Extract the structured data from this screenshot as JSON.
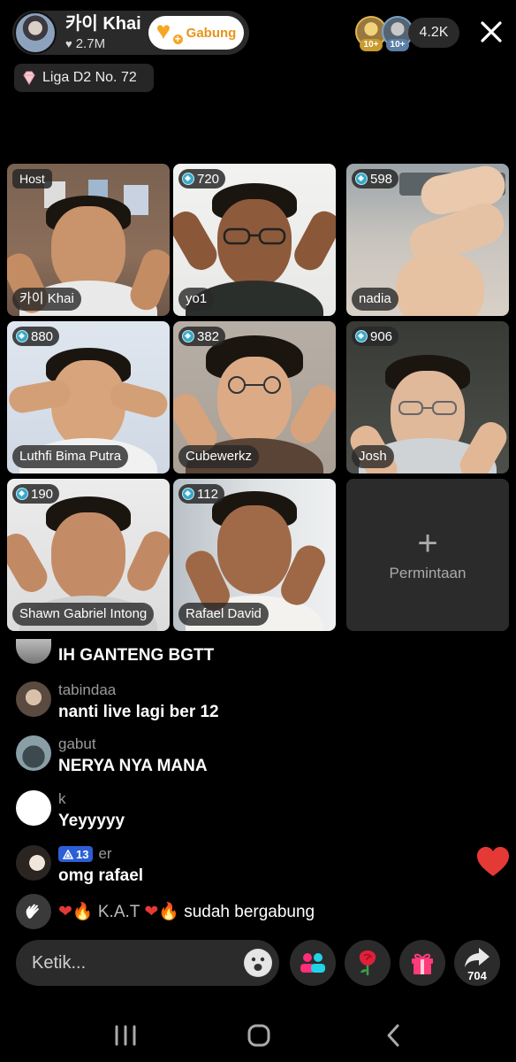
{
  "header": {
    "host_name": "카이 Khai",
    "host_likes": "2.7M",
    "join_label": "Gabung",
    "viewer_ranks": [
      "10+",
      "10+"
    ],
    "viewer_count": "4.2K",
    "league": "Liga D2 No. 72"
  },
  "grid": {
    "host_badge": "Host",
    "tiles": [
      {
        "name": "카이 Khai",
        "badge": "Host"
      },
      {
        "name": "yo1",
        "badge": "720"
      },
      {
        "name": "nadia",
        "badge": "598"
      },
      {
        "name": "Luthfi Bima Putra",
        "badge": "880"
      },
      {
        "name": "Cubewerkz",
        "badge": "382"
      },
      {
        "name": "Josh",
        "badge": "906"
      },
      {
        "name": "Shawn Gabriel Intong",
        "badge": "190"
      },
      {
        "name": "Rafael David",
        "badge": "112"
      }
    ],
    "request_label": "Permintaan"
  },
  "comments": [
    {
      "user": "",
      "text": "IH GANTENG BGTT"
    },
    {
      "user": "tabindaa",
      "text": "nanti live lagi ber 12"
    },
    {
      "user": "gabut",
      "text": "NERYA NYA MANA"
    },
    {
      "user": "k",
      "text": "Yeyyyyy"
    },
    {
      "user": "er",
      "badge_level": "13",
      "text": "omg rafael"
    }
  ],
  "join_event": {
    "user": "K.A.T",
    "action": "sudah bergabung"
  },
  "composer": {
    "placeholder": "Ketik...",
    "share_count": "704"
  },
  "colors": {
    "accent_orange": "#f5a623",
    "like_red": "#e53935",
    "fan_badge_blue": "#2c5fd6"
  }
}
